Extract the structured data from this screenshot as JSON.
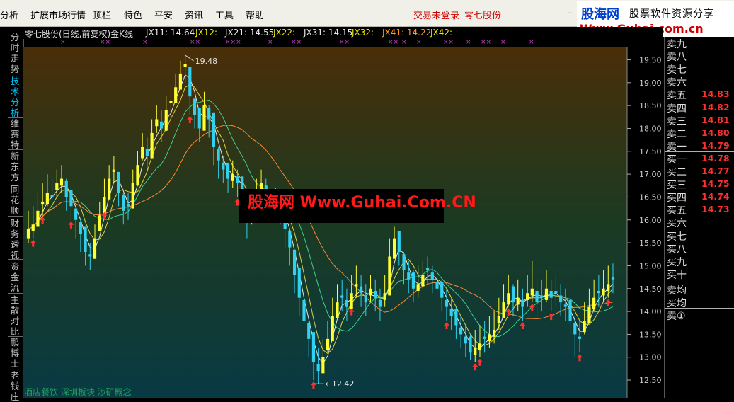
{
  "menu": {
    "items": [
      "分析",
      "扩展市场行情",
      "顶栏",
      "特色",
      "平安",
      "资讯",
      "工具",
      "帮助"
    ],
    "status_login": "交易未登录",
    "status_stock": "零七股份",
    "minimize": "_"
  },
  "brand": {
    "name": "股海网",
    "slogan": "股票软件资源分享",
    "url": "Www.Guhai.com.cn"
  },
  "side_tabs": [
    {
      "label": "分时走势",
      "active": false
    },
    {
      "label": "技术分析",
      "active": true
    },
    {
      "label": "维赛特",
      "active": false
    },
    {
      "label": "新东方",
      "active": false
    },
    {
      "label": "同花顺",
      "active": false
    },
    {
      "label": "财务透视",
      "active": false
    },
    {
      "label": "资金流",
      "active": false
    },
    {
      "label": "主散对比",
      "active": false
    },
    {
      "label": "鹏博士",
      "active": false
    },
    {
      "label": "老钱庄",
      "active": false
    }
  ],
  "chart_header": {
    "title": "零七股份(日线,前复权)金K线",
    "ma": [
      {
        "label": "JX11: 14.64",
        "color": "#e8e8e8"
      },
      {
        "label": "JX12: -",
        "color": "#e8e800"
      },
      {
        "label": "JX21: 14.55",
        "color": "#e8e8e8"
      },
      {
        "label": "JX22: -",
        "color": "#e8e800"
      },
      {
        "label": "JX31: 14.15",
        "color": "#e8e8e8"
      },
      {
        "label": "JX32: -",
        "color": "#e8e800"
      },
      {
        "label": "JX41: 14.22",
        "color": "#ff9a30"
      },
      {
        "label": "JX42: -",
        "color": "#e8e800"
      }
    ],
    "signals": [
      "×",
      "××",
      "×",
      "××",
      "×××",
      "×",
      "××",
      "××",
      "××",
      "×",
      "×",
      "××",
      "×",
      "××",
      "×",
      "×"
    ]
  },
  "watermark": "股海网 Www.Guhai.Com.CN",
  "concept_tags": "酒店餐饮  深圳板块  涉矿概念",
  "colors": {
    "up": "#ffff30",
    "down": "#30d0f0",
    "ma_white": "#e8e8e8",
    "ma_yellow": "#e0d040",
    "ma_green": "#40d090",
    "ma_orange": "#ff8a30",
    "sell_arrow": "#ff3030"
  },
  "chart_data": {
    "type": "candlestick",
    "ylim": [
      12.3,
      19.6
    ],
    "yticks": [
      "19.50",
      "19.00",
      "18.50",
      "18.00",
      "17.50",
      "17.00",
      "16.50",
      "16.00",
      "15.50",
      "15.00",
      "14.50",
      "14.00",
      "13.50",
      "13.00",
      "12.50"
    ],
    "high_label": "19.48",
    "low_label": "12.42",
    "close": [
      15.8,
      15.9,
      16.2,
      16.4,
      16.6,
      16.5,
      16.8,
      16.9,
      16.5,
      16.3,
      16.0,
      15.7,
      15.3,
      15.2,
      15.6,
      16.1,
      16.5,
      16.9,
      17.1,
      16.6,
      16.2,
      16.3,
      16.8,
      17.2,
      17.6,
      17.4,
      17.9,
      18.2,
      18.0,
      18.4,
      18.6,
      18.9,
      19.2,
      19.4,
      18.7,
      18.3,
      18.0,
      18.5,
      18.2,
      17.6,
      17.3,
      17.1,
      16.9,
      17.0,
      16.8,
      16.5,
      16.0,
      16.2,
      16.6,
      16.8,
      16.5,
      16.3,
      16.4,
      16.2,
      15.8,
      15.4,
      14.8,
      14.3,
      13.8,
      13.4,
      12.9,
      12.7,
      13.0,
      13.4,
      13.9,
      14.2,
      14.3,
      14.1,
      14.4,
      14.6,
      14.4,
      14.2,
      14.5,
      14.3,
      14.1,
      14.4,
      15.2,
      15.6,
      15.3,
      14.9,
      14.7,
      14.5,
      14.6,
      14.8,
      14.9,
      14.7,
      14.5,
      14.3,
      14.1,
      13.9,
      13.7,
      13.5,
      13.3,
      13.1,
      13.2,
      13.3,
      13.4,
      13.5,
      13.6,
      13.9,
      14.2,
      14.4,
      14.2,
      14.3,
      14.1,
      14.4,
      14.5,
      14.2,
      14.3,
      14.5,
      14.3,
      14.4,
      14.2,
      14.1,
      13.8,
      13.5,
      13.4,
      13.8,
      14.1,
      14.3,
      14.4,
      14.5,
      14.6,
      14.7
    ],
    "high": [
      16.2,
      16.3,
      16.6,
      16.8,
      17.0,
      16.9,
      17.1,
      17.2,
      16.9,
      16.6,
      16.4,
      16.0,
      15.7,
      15.5,
      15.9,
      16.4,
      16.9,
      17.2,
      17.4,
      17.0,
      16.6,
      16.6,
      17.1,
      17.5,
      17.9,
      17.8,
      18.2,
      18.5,
      18.4,
      18.7,
      18.9,
      19.2,
      19.48,
      19.6,
      19.0,
      18.6,
      18.4,
      18.8,
      18.5,
      18.0,
      17.6,
      17.4,
      17.2,
      17.3,
      17.1,
      16.9,
      16.4,
      16.5,
      16.9,
      17.1,
      16.9,
      16.6,
      16.7,
      16.5,
      16.2,
      15.8,
      15.2,
      14.7,
      14.2,
      13.8,
      13.3,
      13.2,
      13.4,
      13.8,
      14.3,
      14.6,
      14.7,
      14.5,
      14.8,
      15.0,
      14.8,
      14.6,
      14.8,
      14.7,
      14.5,
      14.8,
      15.6,
      15.85,
      15.7,
      15.3,
      15.1,
      14.9,
      15.0,
      15.1,
      15.2,
      15.0,
      14.9,
      14.7,
      14.5,
      14.3,
      14.1,
      13.9,
      13.7,
      13.5,
      13.6,
      13.7,
      13.8,
      13.9,
      14.0,
      14.3,
      14.6,
      14.8,
      14.6,
      14.7,
      14.5,
      14.8,
      15.1,
      14.7,
      14.7,
      14.9,
      14.7,
      14.8,
      14.6,
      14.5,
      14.2,
      13.9,
      13.8,
      14.2,
      14.5,
      14.7,
      14.8,
      14.9,
      15.0,
      15.05
    ],
    "low": [
      15.5,
      15.6,
      15.9,
      16.1,
      16.3,
      16.2,
      16.5,
      16.6,
      16.2,
      16.0,
      15.6,
      15.3,
      15.0,
      14.9,
      15.3,
      15.8,
      16.2,
      16.6,
      16.8,
      16.3,
      15.9,
      16.0,
      16.5,
      16.9,
      17.3,
      17.1,
      17.6,
      17.9,
      17.7,
      18.1,
      18.3,
      18.6,
      18.9,
      19.0,
      18.3,
      18.0,
      17.7,
      18.2,
      17.8,
      17.2,
      16.9,
      16.8,
      16.6,
      16.7,
      16.5,
      16.2,
      15.6,
      15.9,
      16.3,
      16.5,
      16.2,
      16.0,
      16.1,
      15.9,
      15.4,
      15.0,
      14.4,
      13.9,
      13.4,
      13.0,
      12.5,
      12.42,
      12.7,
      13.1,
      13.6,
      13.9,
      14.0,
      13.8,
      14.1,
      14.3,
      14.1,
      13.9,
      14.2,
      14.0,
      13.8,
      14.1,
      14.9,
      15.3,
      15.0,
      14.6,
      14.4,
      14.2,
      14.3,
      14.5,
      14.6,
      14.4,
      14.2,
      14.0,
      13.8,
      13.6,
      13.4,
      13.2,
      13.0,
      12.95,
      12.9,
      13.0,
      13.1,
      13.2,
      13.3,
      13.6,
      13.9,
      14.1,
      13.9,
      14.0,
      13.8,
      14.1,
      14.2,
      13.9,
      14.0,
      14.2,
      14.0,
      14.1,
      13.9,
      13.8,
      13.5,
      13.0,
      13.1,
      13.5,
      13.8,
      14.0,
      14.1,
      14.2,
      14.3,
      14.4
    ]
  },
  "order_book": {
    "rows": [
      {
        "label": "卖九",
        "price": ""
      },
      {
        "label": "卖八",
        "price": ""
      },
      {
        "label": "卖七",
        "price": ""
      },
      {
        "label": "卖六",
        "price": ""
      },
      {
        "label": "卖五",
        "price": "14.83"
      },
      {
        "label": "卖四",
        "price": "14.82"
      },
      {
        "label": "卖三",
        "price": "14.81"
      },
      {
        "label": "卖二",
        "price": "14.80"
      },
      {
        "label": "卖一",
        "price": "14.79"
      },
      {
        "label": "买一",
        "price": "14.78"
      },
      {
        "label": "买二",
        "price": "14.77"
      },
      {
        "label": "买三",
        "price": "14.75"
      },
      {
        "label": "买四",
        "price": "14.74"
      },
      {
        "label": "买五",
        "price": "14.73"
      },
      {
        "label": "买六",
        "price": ""
      },
      {
        "label": "买七",
        "price": ""
      },
      {
        "label": "买八",
        "price": ""
      },
      {
        "label": "买九",
        "price": ""
      },
      {
        "label": "买十",
        "price": ""
      }
    ],
    "sell_avg": "卖均",
    "buy_avg": "买均",
    "sell_circle": "卖①"
  }
}
